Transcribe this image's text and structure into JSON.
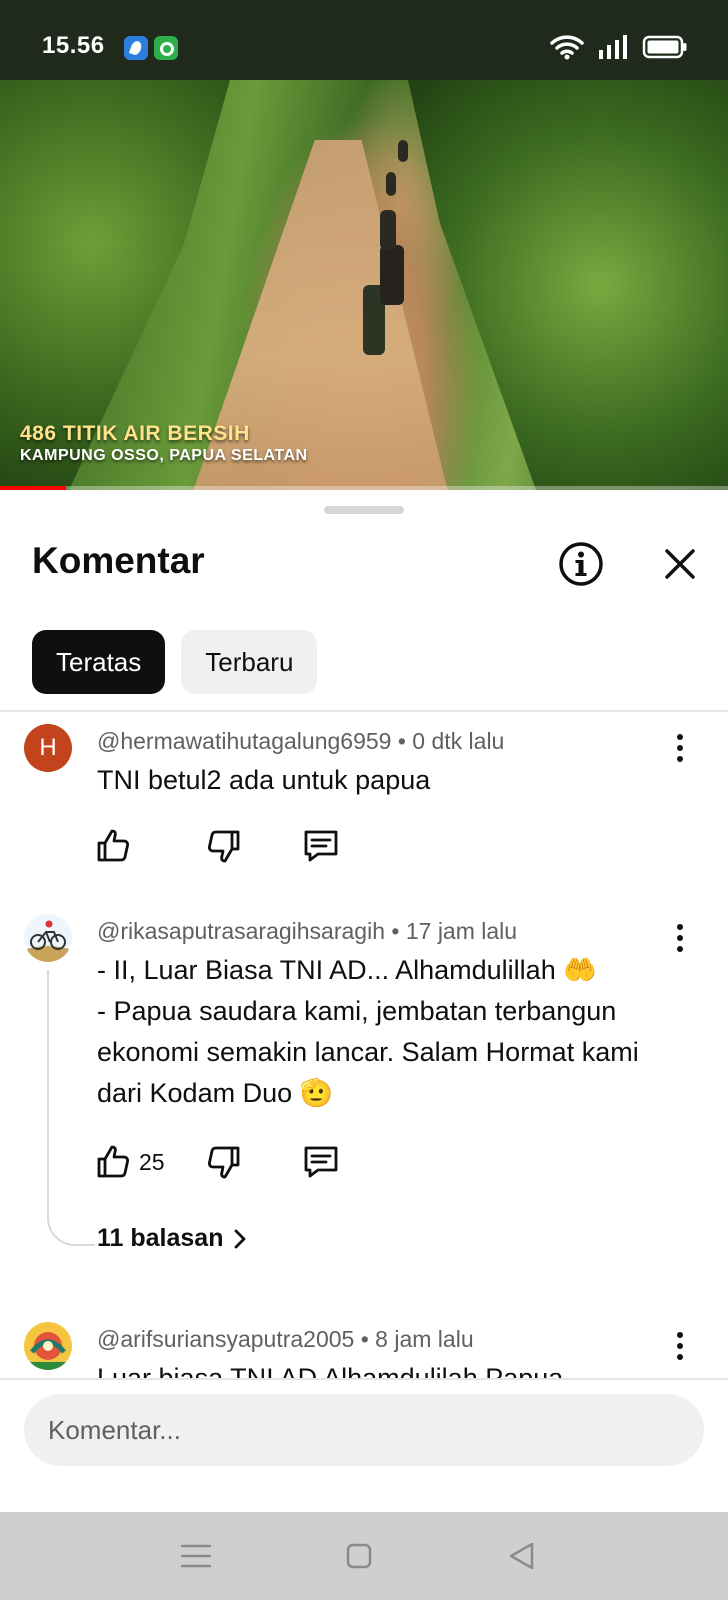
{
  "status_bar": {
    "time": "15.56",
    "app_icons": [
      "blue-app-icon",
      "green-app-icon"
    ],
    "indicators": [
      "wifi-icon",
      "signal-icon",
      "battery-icon"
    ]
  },
  "video": {
    "overlay_title": "486 TITIK AIR BERSIH",
    "overlay_subtitle": "KAMPUNG OSSO, PAPUA SELATAN",
    "progress": 0.09,
    "progress_color": "#ff0000"
  },
  "sheet": {
    "title": "Komentar",
    "info_icon": "info-icon",
    "close_icon": "close-icon",
    "tabs": [
      {
        "label": "Teratas",
        "active": true
      },
      {
        "label": "Terbaru",
        "active": false
      }
    ]
  },
  "comments": [
    {
      "avatar_letter": "H",
      "avatar_color": "#c3431c",
      "author": "@hermawatihutagalung6959",
      "time": "0 dtk lalu",
      "lines": [
        "TNI betul2 ada untuk papua"
      ],
      "likes": ""
    },
    {
      "avatar_icon": "cyclist-avatar-icon",
      "author": "@rikasaputrasaragihsaragih",
      "time": "17 jam lalu",
      "lines": [
        "- II, Luar Biasa TNI AD... Alhamdulillah 🤲",
        "- Papua saudara kami, jembatan terbangun",
        "ekonomi semakin lancar. Salam Hormat kami",
        "dari Kodam Duo 🫡"
      ],
      "likes": "25",
      "replies": "11 balasan"
    },
    {
      "avatar_icon": "colorful-avatar-icon",
      "author": "@arifsuriansyaputra2005",
      "time": "8 jam lalu",
      "lines": [
        "Luar biasa TNI AD Alhamdulilah Papua"
      ]
    }
  ],
  "composer": {
    "placeholder": "Komentar..."
  },
  "nav": {
    "buttons": [
      "menu-icon",
      "home-icon",
      "back-icon"
    ]
  }
}
